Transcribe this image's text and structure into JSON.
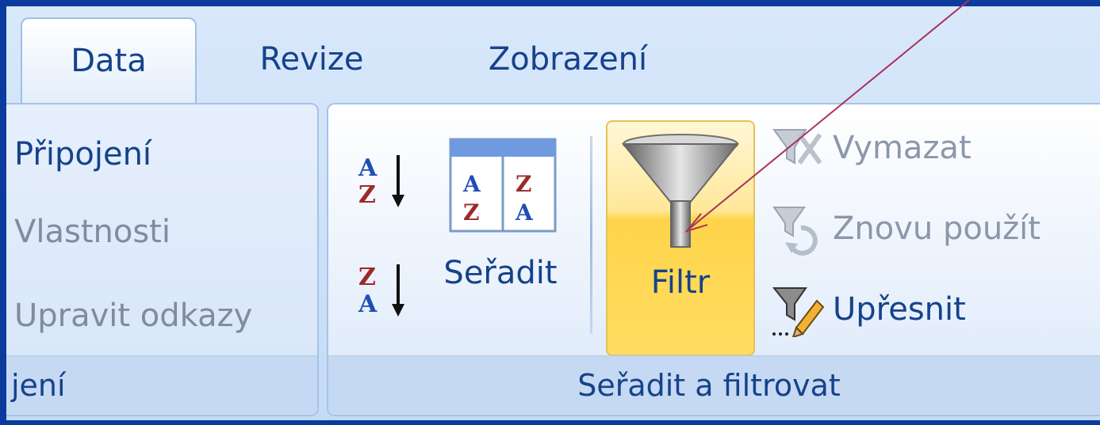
{
  "tabs": [
    {
      "label": "Data",
      "active": true
    },
    {
      "label": "Revize",
      "active": false
    },
    {
      "label": "Zobrazení",
      "active": false
    }
  ],
  "connections_group": {
    "items": [
      "Připojení",
      "Vlastnosti",
      "Upravit odkazy"
    ],
    "caption": "jení"
  },
  "sort_filter_group": {
    "sort_label": "Seřadit",
    "filter_label": "Filtr",
    "clear_label": "Vymazat",
    "reapply_label": "Znovu použít",
    "advanced_label": "Upřesnit",
    "caption": "Seřadit a filtrovat"
  },
  "icons": [
    "sort-a-z-icon",
    "sort-z-a-icon",
    "sort-dialog-icon",
    "filter-funnel-icon",
    "clear-filter-icon",
    "reapply-filter-icon",
    "advanced-filter-icon"
  ],
  "colors": {
    "background": "#0b3b9c",
    "ribbon": "#c4dbf6",
    "text": "#15428b",
    "highlight": "#ffd44a",
    "annotation_arrow": "#a8325a"
  }
}
